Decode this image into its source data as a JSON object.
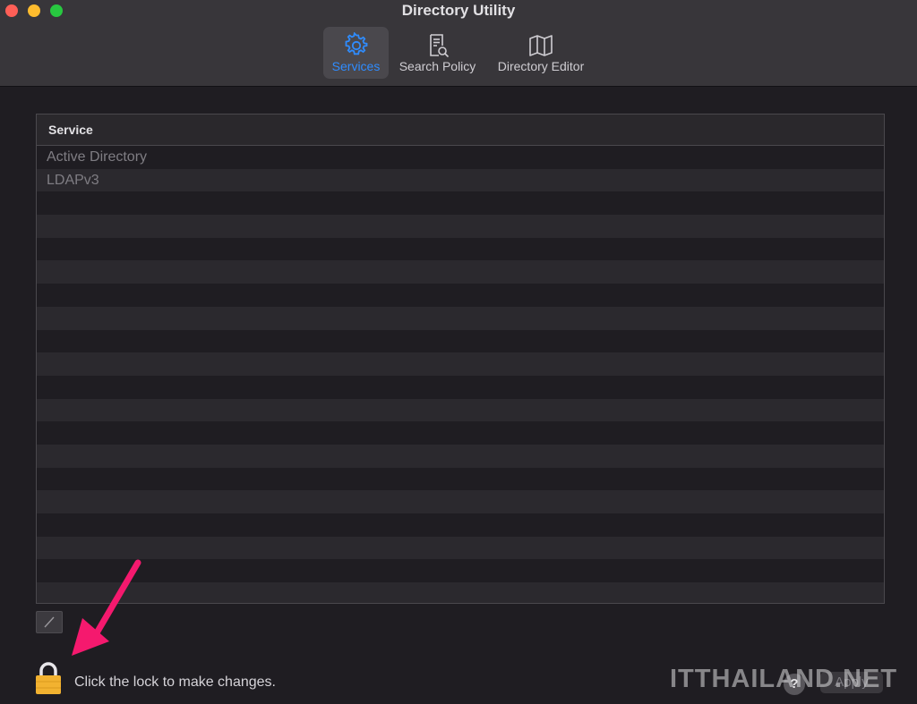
{
  "window": {
    "title": "Directory Utility"
  },
  "toolbar": {
    "tabs": [
      {
        "label": "Services",
        "icon": "gear-icon",
        "active": true
      },
      {
        "label": "Search Policy",
        "icon": "search-document-icon",
        "active": false
      },
      {
        "label": "Directory Editor",
        "icon": "map-icon",
        "active": false
      }
    ]
  },
  "table": {
    "column_header": "Service",
    "rows": [
      "Active Directory",
      "LDAPv3",
      "",
      "",
      "",
      "",
      "",
      "",
      "",
      "",
      "",
      "",
      "",
      "",
      "",
      "",
      "",
      "",
      "",
      ""
    ]
  },
  "edit_button": {
    "icon": "pencil-icon"
  },
  "footer": {
    "lock_icon": "lock-icon",
    "lock_text": "Click the lock to make changes.",
    "help_label": "?",
    "apply_label": "Apply"
  },
  "watermark": "ITTHAILAND.NET",
  "colors": {
    "accent": "#2f8cff",
    "annotation_arrow": "#f5196e",
    "lock": "#f2b230"
  }
}
